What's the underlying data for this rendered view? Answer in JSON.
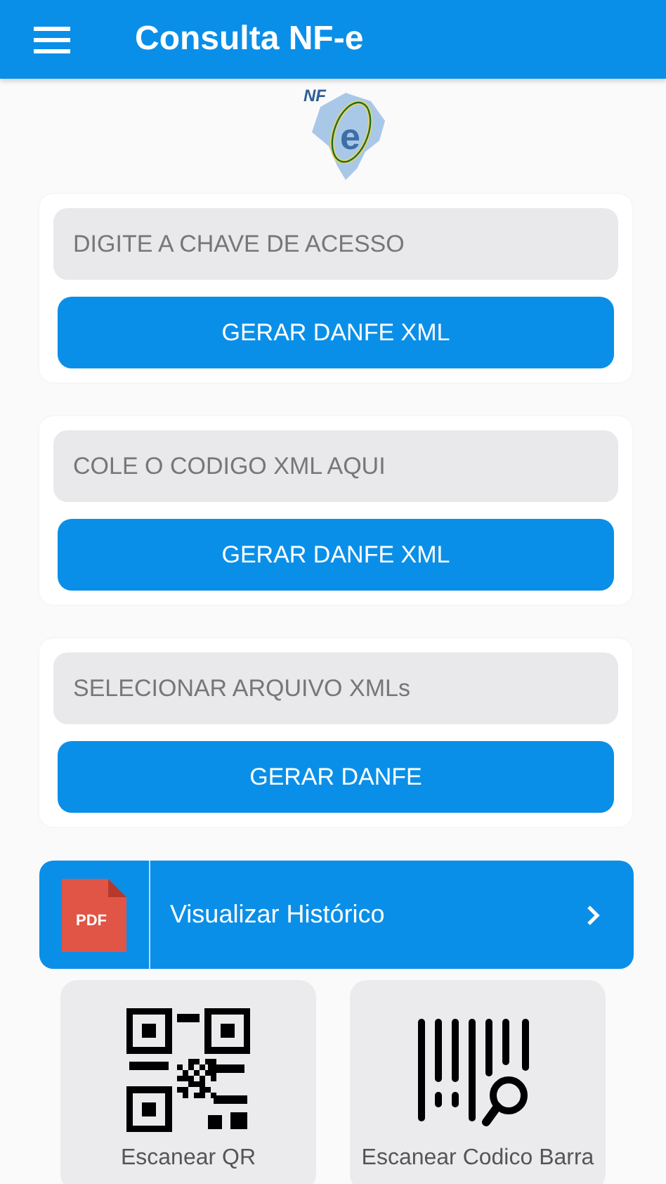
{
  "app_bar": {
    "title": "Consulta NF-e"
  },
  "logo": {
    "text": "NF",
    "mark": "e"
  },
  "sections": [
    {
      "placeholder": "DIGITE A CHAVE DE ACESSO",
      "button": "GERAR DANFE XML"
    },
    {
      "placeholder": "COLE O CODIGO XML AQUI",
      "button": "GERAR DANFE XML"
    },
    {
      "placeholder": "SELECIONAR ARQUIVO XMLs",
      "button": "GERAR DANFE"
    }
  ],
  "history": {
    "icon_text": "PDF",
    "label": "Visualizar Histórico"
  },
  "scan_tiles": [
    {
      "kind": "qr",
      "label": "Escanear QR"
    },
    {
      "kind": "barcode",
      "label": "Escanear Codico Barra"
    }
  ]
}
